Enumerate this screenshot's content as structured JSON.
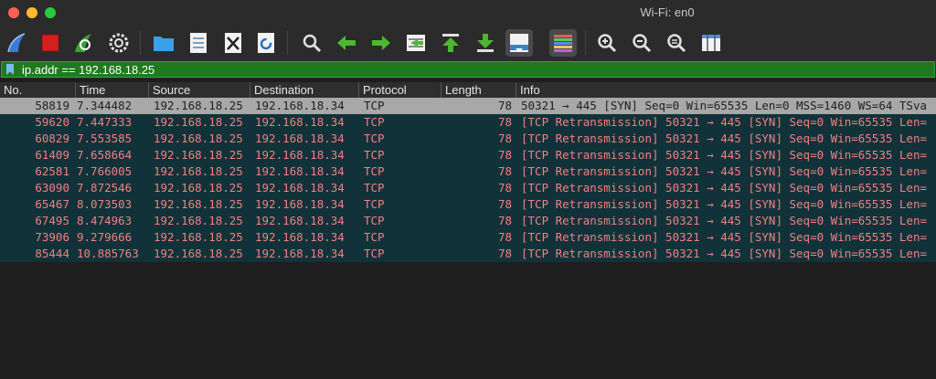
{
  "window": {
    "title": "Wi-Fi: en0"
  },
  "toolbar": {
    "buttons": [
      {
        "name": "start-capture-icon"
      },
      {
        "name": "stop-capture-icon"
      },
      {
        "name": "restart-capture-icon"
      },
      {
        "name": "capture-options-icon"
      },
      {
        "name": "open-file-icon"
      },
      {
        "name": "save-file-icon"
      },
      {
        "name": "close-file-icon"
      },
      {
        "name": "reload-file-icon"
      },
      {
        "name": "find-packet-icon"
      },
      {
        "name": "go-back-icon"
      },
      {
        "name": "go-forward-icon"
      },
      {
        "name": "go-to-packet-icon"
      },
      {
        "name": "go-first-packet-icon"
      },
      {
        "name": "go-last-packet-icon"
      },
      {
        "name": "autoscroll-icon"
      },
      {
        "name": "colorize-icon"
      },
      {
        "name": "zoom-in-icon"
      },
      {
        "name": "zoom-out-icon"
      },
      {
        "name": "zoom-normal-icon"
      },
      {
        "name": "resize-columns-icon"
      }
    ]
  },
  "filter": {
    "value": "ip.addr == 192.168.18.25"
  },
  "columns": [
    "No.",
    "Time",
    "Source",
    "Destination",
    "Protocol",
    "Length",
    "Info"
  ],
  "packets": [
    {
      "no": "58819",
      "time": "7.344482",
      "src": "192.168.18.25",
      "dst": "192.168.18.34",
      "proto": "TCP",
      "len": "78",
      "info": "50321 → 445 [SYN] Seq=0 Win=65535 Len=0 MSS=1460 WS=64 TSva"
    },
    {
      "no": "59620",
      "time": "7.447333",
      "src": "192.168.18.25",
      "dst": "192.168.18.34",
      "proto": "TCP",
      "len": "78",
      "info": "[TCP Retransmission] 50321 → 445 [SYN] Seq=0 Win=65535 Len="
    },
    {
      "no": "60829",
      "time": "7.553585",
      "src": "192.168.18.25",
      "dst": "192.168.18.34",
      "proto": "TCP",
      "len": "78",
      "info": "[TCP Retransmission] 50321 → 445 [SYN] Seq=0 Win=65535 Len="
    },
    {
      "no": "61409",
      "time": "7.658664",
      "src": "192.168.18.25",
      "dst": "192.168.18.34",
      "proto": "TCP",
      "len": "78",
      "info": "[TCP Retransmission] 50321 → 445 [SYN] Seq=0 Win=65535 Len="
    },
    {
      "no": "62581",
      "time": "7.766005",
      "src": "192.168.18.25",
      "dst": "192.168.18.34",
      "proto": "TCP",
      "len": "78",
      "info": "[TCP Retransmission] 50321 → 445 [SYN] Seq=0 Win=65535 Len="
    },
    {
      "no": "63090",
      "time": "7.872546",
      "src": "192.168.18.25",
      "dst": "192.168.18.34",
      "proto": "TCP",
      "len": "78",
      "info": "[TCP Retransmission] 50321 → 445 [SYN] Seq=0 Win=65535 Len="
    },
    {
      "no": "65467",
      "time": "8.073503",
      "src": "192.168.18.25",
      "dst": "192.168.18.34",
      "proto": "TCP",
      "len": "78",
      "info": "[TCP Retransmission] 50321 → 445 [SYN] Seq=0 Win=65535 Len="
    },
    {
      "no": "67495",
      "time": "8.474963",
      "src": "192.168.18.25",
      "dst": "192.168.18.34",
      "proto": "TCP",
      "len": "78",
      "info": "[TCP Retransmission] 50321 → 445 [SYN] Seq=0 Win=65535 Len="
    },
    {
      "no": "73906",
      "time": "9.279666",
      "src": "192.168.18.25",
      "dst": "192.168.18.34",
      "proto": "TCP",
      "len": "78",
      "info": "[TCP Retransmission] 50321 → 445 [SYN] Seq=0 Win=65535 Len="
    },
    {
      "no": "85444",
      "time": "10.885763",
      "src": "192.168.18.25",
      "dst": "192.168.18.34",
      "proto": "TCP",
      "len": "78",
      "info": "[TCP Retransmission] 50321 → 445 [SYN] Seq=0 Win=65535 Len="
    }
  ],
  "colors": {
    "retransmission_text": "#f08080",
    "row_bg": "#12323a",
    "selected_bg": "#a8a8a8",
    "filter_bg": "#1f7a1f"
  }
}
